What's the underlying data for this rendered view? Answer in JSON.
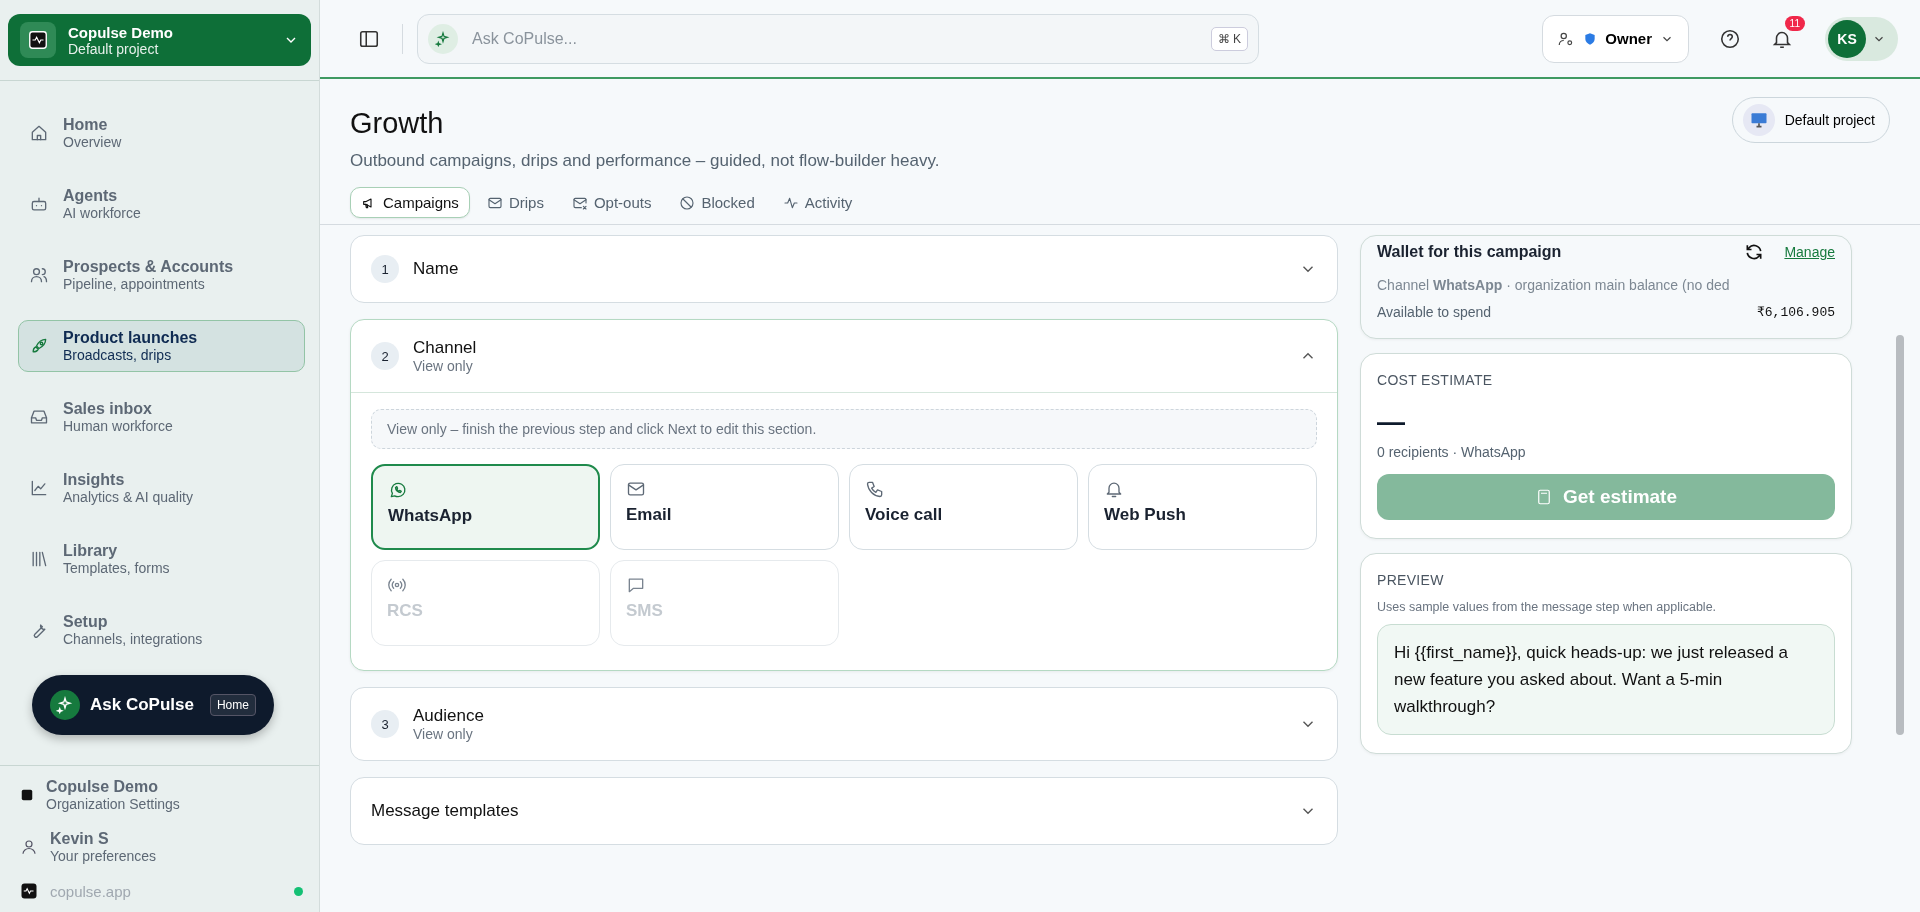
{
  "workspace": {
    "name": "Copulse Demo",
    "project": "Default project"
  },
  "nav": [
    {
      "title": "Home",
      "subtitle": "Overview",
      "selected": false
    },
    {
      "title": "Agents",
      "subtitle": "AI workforce",
      "selected": false
    },
    {
      "title": "Prospects & Accounts",
      "subtitle": "Pipeline, appointments",
      "selected": false
    },
    {
      "title": "Product launches",
      "subtitle": "Broadcasts, drips",
      "selected": true
    },
    {
      "title": "Sales inbox",
      "subtitle": "Human workforce",
      "selected": false
    },
    {
      "title": "Insights",
      "subtitle": "Analytics & AI quality",
      "selected": false
    },
    {
      "title": "Library",
      "subtitle": "Templates, forms",
      "selected": false
    },
    {
      "title": "Setup",
      "subtitle": "Channels, integrations",
      "selected": false
    }
  ],
  "ask_button": {
    "label": "Ask CoPulse",
    "tag": "Home"
  },
  "sidebar_footer": {
    "org": {
      "title": "Copulse Demo",
      "subtitle": "Organization Settings"
    },
    "user": {
      "title": "Kevin S",
      "subtitle": "Your preferences"
    },
    "domain": "copulse.app",
    "online": true
  },
  "topbar": {
    "search_placeholder": "Ask CoPulse...",
    "shortcut": "⌘ K",
    "role": "Owner",
    "notifications": "11",
    "avatar": "KS"
  },
  "page": {
    "title": "Growth",
    "subtitle": "Outbound campaigns, drips and performance – guided, not flow-builder heavy.",
    "project_button": "Default project"
  },
  "tabs": [
    {
      "label": "Campaigns",
      "selected": true
    },
    {
      "label": "Drips",
      "selected": false
    },
    {
      "label": "Opt-outs",
      "selected": false
    },
    {
      "label": "Blocked",
      "selected": false
    },
    {
      "label": "Activity",
      "selected": false
    }
  ],
  "steps": [
    {
      "number": "1",
      "title": "Name",
      "expanded": false
    },
    {
      "number": "2",
      "title": "Channel",
      "subtitle": "View only",
      "expanded": true
    },
    {
      "number": "3",
      "title": "Audience",
      "subtitle": "View only",
      "expanded": false
    },
    {
      "title": "Message templates",
      "expanded": false
    }
  ],
  "channel_note": "View only – finish the previous step and click Next to edit this section.",
  "channels": [
    {
      "label": "WhatsApp",
      "selected": true,
      "disabled": false
    },
    {
      "label": "Email",
      "selected": false,
      "disabled": false
    },
    {
      "label": "Voice call",
      "selected": false,
      "disabled": false
    },
    {
      "label": "Web Push",
      "selected": false,
      "disabled": false
    },
    {
      "label": "RCS",
      "selected": false,
      "disabled": true
    },
    {
      "label": "SMS",
      "selected": false,
      "disabled": true
    }
  ],
  "wallet": {
    "title": "Wallet for this campaign",
    "manage": "Manage",
    "note": "Channel **WhatsApp** · organization main balance (no ded",
    "available_label": "Available to spend",
    "available": "₹6,106.905"
  },
  "cost": {
    "heading": "COST ESTIMATE",
    "value": "—",
    "detail": "0 recipients · WhatsApp",
    "button": "Get estimate"
  },
  "preview": {
    "heading": "PREVIEW",
    "hint": "Uses sample values from the message step when applicable.",
    "message": "Hi {{first_name}}, quick heads-up: we just released a new feature you asked about. Want a 5-min walkthrough?"
  }
}
